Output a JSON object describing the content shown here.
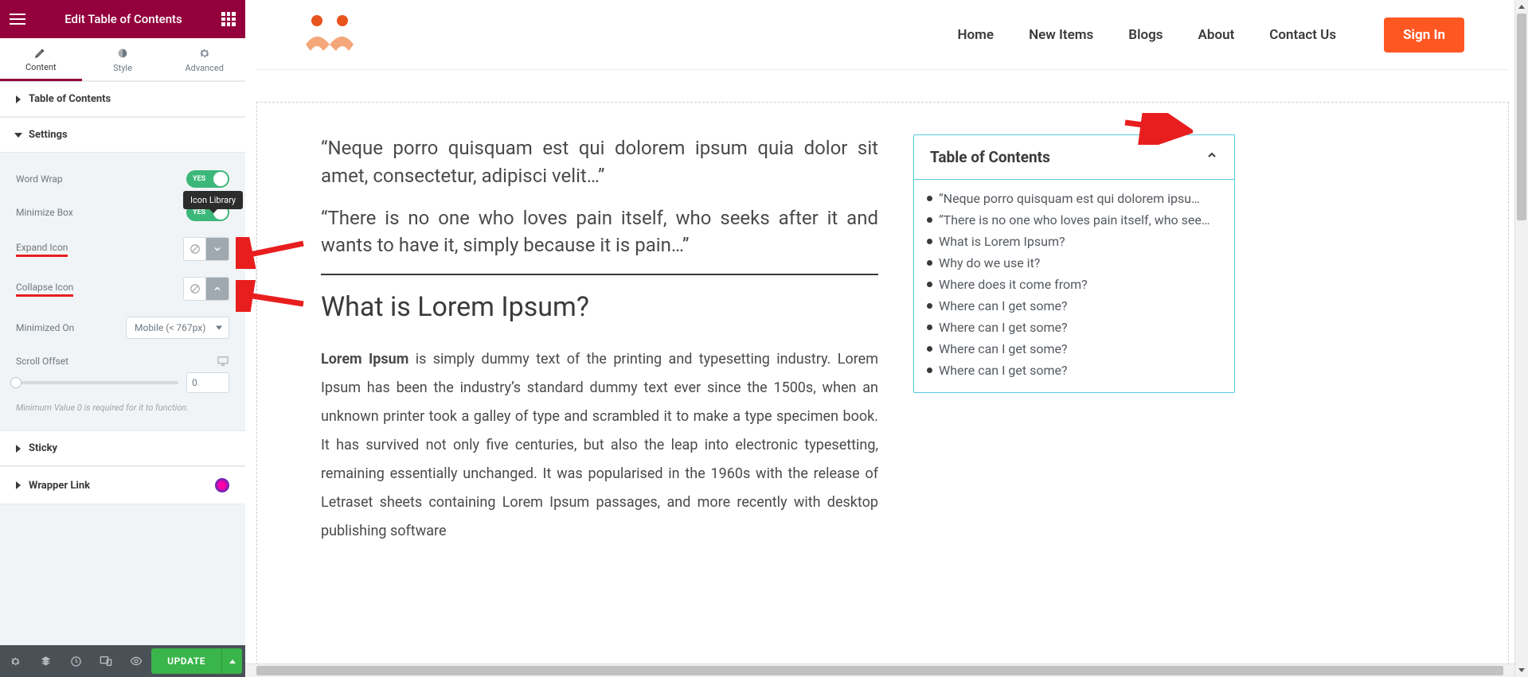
{
  "panel": {
    "title": "Edit Table of Contents",
    "tabs": {
      "content": "Content",
      "style": "Style",
      "advanced": "Advanced"
    },
    "sections": {
      "toc": "Table of Contents",
      "settings": "Settings",
      "sticky": "Sticky",
      "wrapper": "Wrapper Link"
    },
    "controls": {
      "word_wrap": "Word Wrap",
      "minimize_box": "Minimize Box",
      "expand_icon": "Expand Icon",
      "collapse_icon": "Collapse Icon",
      "minimized_on": "Minimized On",
      "minimized_on_value": "Mobile (< 767px)",
      "scroll_offset": "Scroll Offset",
      "scroll_value": "0",
      "hint": "Minimum Value 0 is required for it to function.",
      "toggle_yes": "YES"
    },
    "tooltip": "Icon Library",
    "footer": {
      "update": "UPDATE"
    }
  },
  "site": {
    "nav": {
      "home": "Home",
      "new_items": "New Items",
      "blogs": "Blogs",
      "about": "About",
      "contact": "Contact Us"
    },
    "signin": "Sign In"
  },
  "article": {
    "quote1": "“Neque porro quisquam est qui dolorem ipsum quia dolor sit amet, consectetur, adipisci velit…”",
    "quote2": "“There is no one who loves pain itself, who seeks after it and wants to have it, simply because it is pain…”",
    "h2": "What is Lorem Ipsum?",
    "p_strong": "Lorem Ipsum",
    "p_rest": " is simply dummy text of the printing and typesetting industry. Lorem Ipsum has been the industry’s standard dummy text ever since the 1500s, when an unknown printer took a galley of type and scrambled it to make a type specimen book. It has survived not only five centuries, but also the leap into electronic typesetting, remaining essentially unchanged. It was popularised in the 1960s with the release of Letraset sheets containing Lorem Ipsum passages, and more recently with desktop publishing software"
  },
  "toc": {
    "title": "Table of Contents",
    "items": [
      "“Neque porro quisquam est qui dolorem ipsu…",
      "“There is no one who loves pain itself, who see…",
      "What is Lorem Ipsum?",
      "Why do we use it?",
      "Where does it come from?",
      "Where can I get some?",
      "Where can I get some?",
      "Where can I get some?",
      "Where can I get some?"
    ]
  }
}
